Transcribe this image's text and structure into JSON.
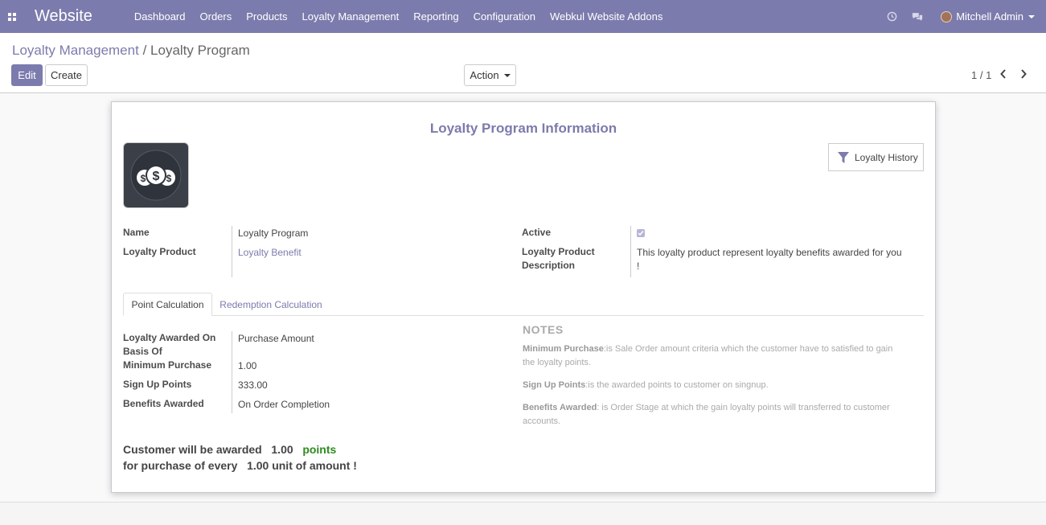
{
  "navbar": {
    "brand": "Website",
    "menu": [
      "Dashboard",
      "Orders",
      "Products",
      "Loyalty Management",
      "Reporting",
      "Configuration",
      "Webkul Website Addons"
    ],
    "user": "Mitchell Admin"
  },
  "control": {
    "breadcrumb_parent": "Loyalty Management",
    "breadcrumb_sep": "/",
    "breadcrumb_current": "Loyalty Program",
    "edit_label": "Edit",
    "create_label": "Create",
    "action_label": "Action",
    "pager": "1 / 1"
  },
  "form": {
    "title": "Loyalty Program Information",
    "smart_button": "Loyalty History",
    "name_label": "Name",
    "name_value": "Loyalty Program",
    "product_label": "Loyalty Product",
    "product_value": "Loyalty Benefit",
    "active_label": "Active",
    "active_value": true,
    "desc_label_1": "Loyalty Product",
    "desc_label_2": "Description",
    "desc_value_1": "This loyalty product represent loyalty benefits awarded for you",
    "desc_value_2": "!"
  },
  "tabs": [
    "Point Calculation",
    "Redemption Calculation"
  ],
  "point_calc": {
    "awarded_on_label_1": "Loyalty Awarded On",
    "awarded_on_label_2": "Basis Of",
    "awarded_on_value": "Purchase Amount",
    "min_purchase_label": "Minimum Purchase",
    "min_purchase_value": "1.00",
    "signup_label": "Sign Up Points",
    "signup_value": "333.00",
    "benefits_label": "Benefits Awarded",
    "benefits_value": "On Order Completion"
  },
  "notes": {
    "title": "NOTES",
    "min_purchase_key": "Minimum Purchase",
    "min_purchase_text_1": ":is Sale Order amount criteria which the customer have to satisfied to gain",
    "min_purchase_text_2": "the loyalty points.",
    "signup_key": "Sign Up Points",
    "signup_text": ":is the awarded points to customer on singnup.",
    "benefits_key": "Benefits Awarded",
    "benefits_text_1": ": is Order Stage at which the gain loyalty points will transferred to customer",
    "benefits_text_2": "accounts."
  },
  "summary": {
    "line1_prefix": "Customer will be awarded",
    "line1_value": "1.00",
    "line1_suffix": "points",
    "line2_prefix": "for purchase of every",
    "line2_value": "1.00 unit of amount !"
  },
  "colors": {
    "brand": "#7c7bad",
    "points_green": "#2e8b1f"
  }
}
